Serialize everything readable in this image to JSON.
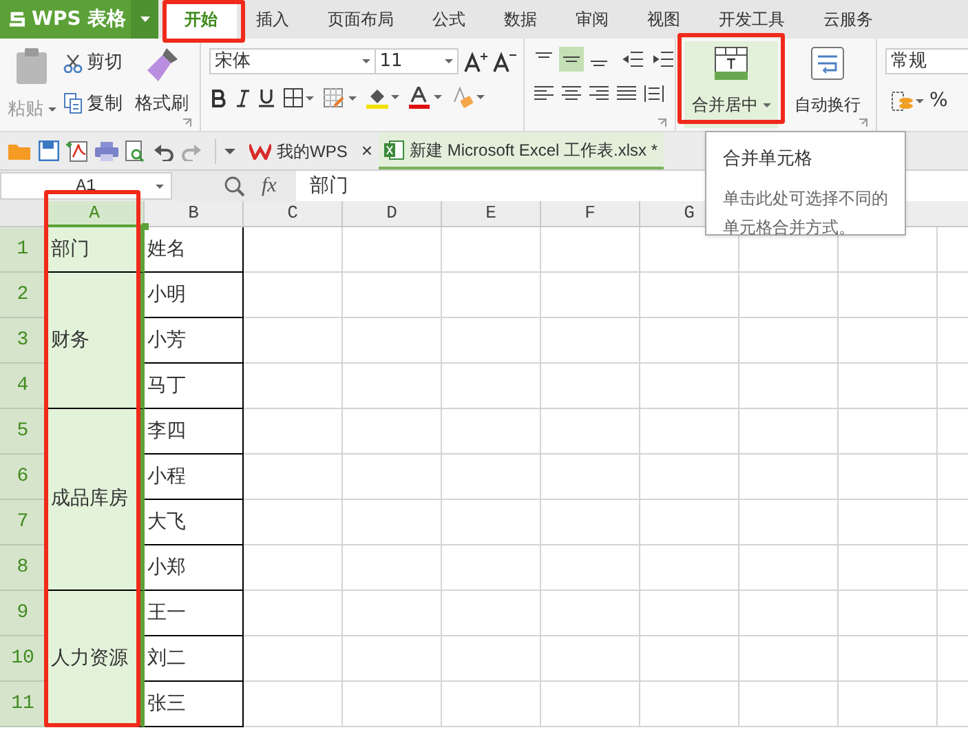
{
  "app": {
    "name": "WPS 表格"
  },
  "tabs": [
    {
      "label": "开始",
      "selected": true
    },
    {
      "label": "插入",
      "selected": false
    },
    {
      "label": "页面布局",
      "selected": false
    },
    {
      "label": "公式",
      "selected": false
    },
    {
      "label": "数据",
      "selected": false
    },
    {
      "label": "审阅",
      "selected": false
    },
    {
      "label": "视图",
      "selected": false
    },
    {
      "label": "开发工具",
      "selected": false
    },
    {
      "label": "云服务",
      "selected": false
    }
  ],
  "ribbon": {
    "paste": "粘贴",
    "cut": "剪切",
    "copy": "复制",
    "format_painter": "格式刷",
    "font_family": "宋体",
    "font_size": "11",
    "vertical_align": [
      {
        "selected": false
      },
      {
        "selected": true
      },
      {
        "selected": false
      }
    ],
    "merge_button": "合并居中",
    "wrap_button": "自动换行",
    "number_format": "常规",
    "percent": "%"
  },
  "doc_tabs": [
    {
      "label": "我的WPS",
      "selected": false,
      "close": "×"
    },
    {
      "label": "新建 Microsoft Excel 工作表.xlsx *",
      "selected": true
    }
  ],
  "formula_bar": {
    "cell_ref": "A1",
    "fx": "fx",
    "content": "部门"
  },
  "columns": [
    {
      "label": "A",
      "selected": true
    },
    {
      "label": "B",
      "selected": false
    },
    {
      "label": "C",
      "selected": false
    },
    {
      "label": "D",
      "selected": false
    },
    {
      "label": "E",
      "selected": false
    },
    {
      "label": "F",
      "selected": false
    },
    {
      "label": "G",
      "selected": false
    }
  ],
  "rows": [
    {
      "label": "1",
      "selected": true
    },
    {
      "label": "2",
      "selected": true
    },
    {
      "label": "3",
      "selected": true
    },
    {
      "label": "4",
      "selected": true
    },
    {
      "label": "5",
      "selected": true
    },
    {
      "label": "6",
      "selected": true
    },
    {
      "label": "7",
      "selected": true
    },
    {
      "label": "8",
      "selected": true
    },
    {
      "label": "9",
      "selected": true
    },
    {
      "label": "10",
      "selected": true
    },
    {
      "label": "11",
      "selected": true
    }
  ],
  "groups": [
    {
      "department": "部门",
      "names": [
        "姓名"
      ]
    },
    {
      "department": "财务",
      "names": [
        "小明",
        "小芳",
        "马丁"
      ]
    },
    {
      "department": "成品库房",
      "names": [
        "李四",
        "小程",
        "大飞",
        "小郑"
      ]
    },
    {
      "department": "人力资源",
      "names": [
        "王一",
        "刘二",
        "张三"
      ]
    }
  ],
  "tooltip": {
    "title": "合并单元格",
    "body": "单击此处可选择不同的单元格合并方式。"
  }
}
